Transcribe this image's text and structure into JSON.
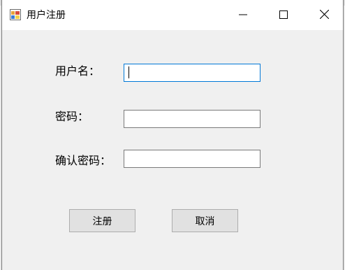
{
  "window": {
    "title": "用户注册",
    "icon": "winforms-app-icon",
    "controls": {
      "minimize_icon": "minimize-icon",
      "maximize_icon": "maximize-icon",
      "close_icon": "close-icon"
    }
  },
  "form": {
    "username_label": "用户名：",
    "username_value": "",
    "password_label": "密码：",
    "password_value": "",
    "confirm_label": "确认密码：",
    "confirm_value": ""
  },
  "buttons": {
    "register_label": "注册",
    "cancel_label": "取消"
  },
  "colors": {
    "focus_border": "#0078d7",
    "window_bg": "#f0f0f0",
    "titlebar_bg": "#ffffff"
  }
}
